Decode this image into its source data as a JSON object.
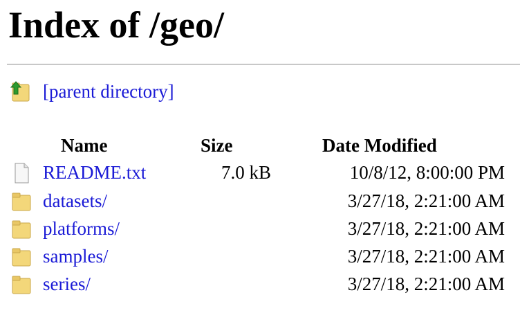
{
  "page": {
    "title": "Index of /geo/"
  },
  "parent": {
    "label": "[parent directory]",
    "icon": "up-arrow-folder-icon"
  },
  "table": {
    "headers": {
      "name": "Name",
      "size": "Size",
      "date": "Date Modified"
    },
    "rows": [
      {
        "name": "README.txt",
        "size": "7.0 kB",
        "date": "10/8/12, 8:00:00 PM",
        "icon": "file-icon"
      },
      {
        "name": "datasets/",
        "size": "",
        "date": "3/27/18, 2:21:00 AM",
        "icon": "folder-icon"
      },
      {
        "name": "platforms/",
        "size": "",
        "date": "3/27/18, 2:21:00 AM",
        "icon": "folder-icon"
      },
      {
        "name": "samples/",
        "size": "",
        "date": "3/27/18, 2:21:00 AM",
        "icon": "folder-icon"
      },
      {
        "name": "series/",
        "size": "",
        "date": "3/27/18, 2:21:00 AM",
        "icon": "folder-icon"
      }
    ]
  },
  "colors": {
    "link": "#1a1ad6",
    "rule": "#c8c8c8",
    "folder": "#f3d77a"
  }
}
